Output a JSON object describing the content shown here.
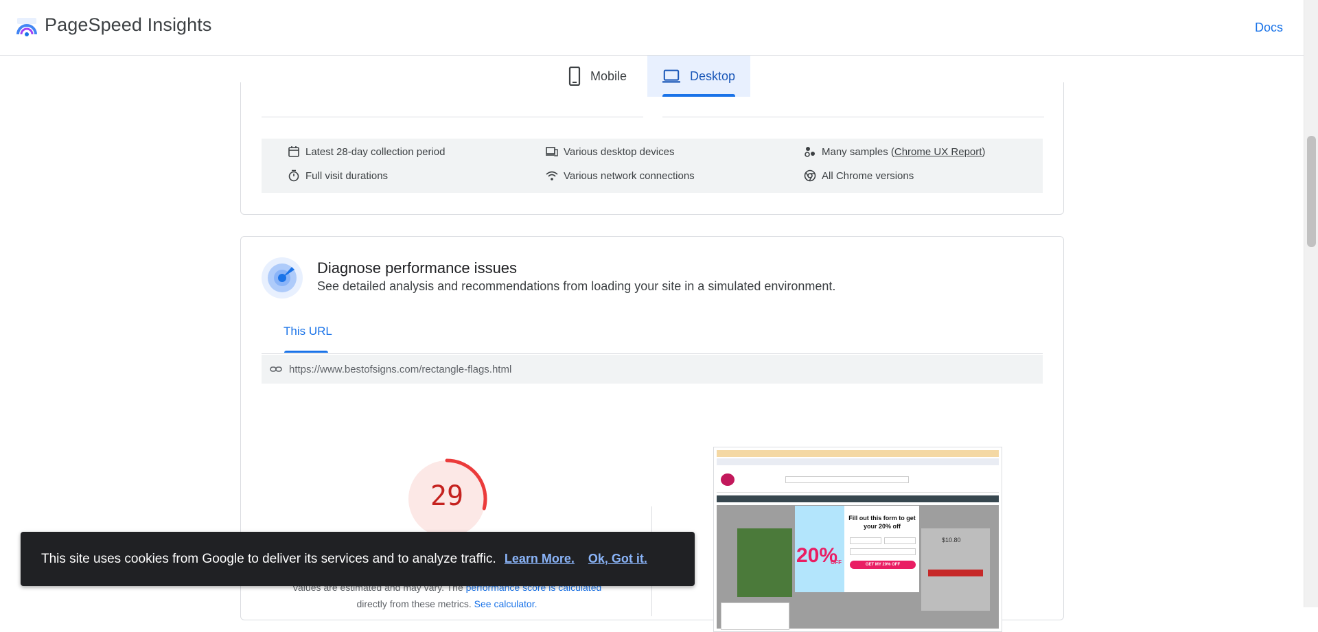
{
  "header": {
    "brand": "PageSpeed Insights",
    "docs_label": "Docs"
  },
  "device_tabs": [
    {
      "label": "Mobile",
      "selected": false
    },
    {
      "label": "Desktop",
      "selected": true
    }
  ],
  "field_info": {
    "collection_period": "Latest 28-day collection period",
    "devices": "Various desktop devices",
    "samples_prefix": "Many samples (",
    "samples_link": "Chrome UX Report",
    "samples_suffix": ")",
    "visit_durations": "Full visit durations",
    "network": "Various network connections",
    "chrome_versions": "All Chrome versions"
  },
  "diagnose": {
    "title": "Diagnose performance issues",
    "subtitle": "See detailed analysis and recommendations from loading your site in a simulated environment.",
    "tab_label": "This URL",
    "url": "https://www.bestofsigns.com/rectangle-flags.html",
    "score": "29",
    "score_fraction": 0.29,
    "note_line1_prefix": "Values are estimated and may vary. The ",
    "note_line1_link": "performance score is calculated",
    "note_line2_prefix": "directly from these metrics. ",
    "note_line2_link": "See calculator."
  },
  "screenshot_preview": {
    "promo_title": "Fill out this form to get your 20% off",
    "promo_badge": "20%",
    "promo_badge_suffix": "OFF",
    "promo_cta": "GET MY 20% OFF",
    "price": "$10.80"
  },
  "cookie_banner": {
    "message": "This site uses cookies from Google to deliver its services and to analyze traffic.",
    "learn_more": "Learn More.",
    "ok": "Ok, Got it."
  },
  "colors": {
    "accent": "#1a73e8",
    "fail": "#c5221f",
    "banner": "#202124"
  }
}
